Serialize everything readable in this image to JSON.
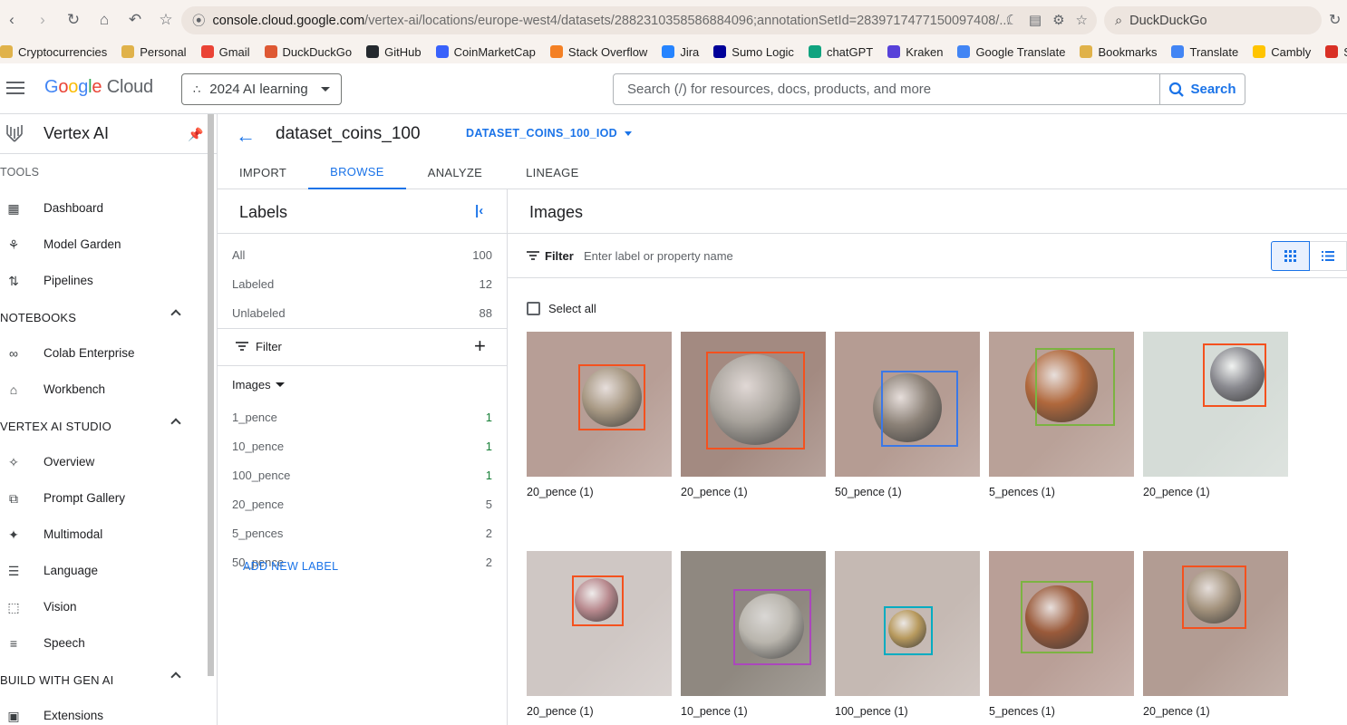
{
  "browser": {
    "url_domain": "console.cloud.google.com",
    "url_path": "/vertex-ai/locations/europe-west4/datasets/2882310358586884096;annotationSetId=2839717477150097408/...",
    "search_engine": "DuckDuckGo",
    "bookmarks": [
      {
        "label": "Cryptocurrencies",
        "color": "#e0b24a"
      },
      {
        "label": "Personal",
        "color": "#e0b24a"
      },
      {
        "label": "Gmail",
        "color": "#ea4335"
      },
      {
        "label": "DuckDuckGo",
        "color": "#de5833"
      },
      {
        "label": "GitHub",
        "color": "#24292e"
      },
      {
        "label": "CoinMarketCap",
        "color": "#3861fb"
      },
      {
        "label": "Stack Overflow",
        "color": "#f48024"
      },
      {
        "label": "Jira",
        "color": "#2684ff"
      },
      {
        "label": "Sumo Logic",
        "color": "#000099"
      },
      {
        "label": "chatGPT",
        "color": "#10a37f"
      },
      {
        "label": "Kraken",
        "color": "#5741d9"
      },
      {
        "label": "Google Translate",
        "color": "#4285f4"
      },
      {
        "label": "Bookmarks",
        "color": "#e0b24a"
      },
      {
        "label": "Translate",
        "color": "#4285f4"
      },
      {
        "label": "Cambly",
        "color": "#ffc400"
      },
      {
        "label": "SwapSw",
        "color": "#d93025"
      }
    ]
  },
  "header": {
    "logo_google": "Google",
    "logo_cloud": "Cloud",
    "project": "2024 AI learning",
    "search_placeholder": "Search (/) for resources, docs, products, and more",
    "search_button": "Search"
  },
  "sidebar": {
    "product": "Vertex AI",
    "sections": [
      {
        "title": "TOOLS",
        "collapsible": false,
        "items": [
          {
            "label": "Dashboard",
            "icon": "dashboard-icon"
          },
          {
            "label": "Model Garden",
            "icon": "model-garden-icon"
          },
          {
            "label": "Pipelines",
            "icon": "pipelines-icon"
          }
        ]
      },
      {
        "title": "NOTEBOOKS",
        "collapsible": true,
        "items": [
          {
            "label": "Colab Enterprise",
            "icon": "colab-icon"
          },
          {
            "label": "Workbench",
            "icon": "workbench-icon"
          }
        ]
      },
      {
        "title": "VERTEX AI STUDIO",
        "collapsible": true,
        "items": [
          {
            "label": "Overview",
            "icon": "overview-icon"
          },
          {
            "label": "Prompt Gallery",
            "icon": "prompt-gallery-icon"
          },
          {
            "label": "Multimodal",
            "icon": "multimodal-icon"
          },
          {
            "label": "Language",
            "icon": "language-icon"
          },
          {
            "label": "Vision",
            "icon": "vision-icon"
          },
          {
            "label": "Speech",
            "icon": "speech-icon"
          }
        ]
      },
      {
        "title": "BUILD WITH GEN AI",
        "collapsible": true,
        "items": [
          {
            "label": "Extensions",
            "icon": "extensions-icon"
          }
        ]
      }
    ]
  },
  "dataset": {
    "title": "dataset_coins_100",
    "selector": "DATASET_COINS_100_IOD",
    "tabs": [
      "IMPORT",
      "BROWSE",
      "ANALYZE",
      "LINEAGE"
    ],
    "active_tab": "BROWSE"
  },
  "labels_panel": {
    "title": "Labels",
    "counts": [
      {
        "label": "All",
        "count": "100"
      },
      {
        "label": "Labeled",
        "count": "12"
      },
      {
        "label": "Unlabeled",
        "count": "88"
      }
    ],
    "filter": "Filter",
    "images_dropdown": "Images",
    "labels": [
      {
        "label": "1_pence",
        "count": "1"
      },
      {
        "label": "10_pence",
        "count": "1"
      },
      {
        "label": "100_pence",
        "count": "1"
      },
      {
        "label": "20_pence",
        "count": "5"
      },
      {
        "label": "5_pences",
        "count": "2"
      },
      {
        "label": "50_pence",
        "count": "2"
      }
    ],
    "add_label": "ADD NEW LABEL"
  },
  "images_panel": {
    "title": "Images",
    "filter_label": "Filter",
    "filter_placeholder": "Enter label or property name",
    "select_all": "Select all",
    "images": [
      {
        "caption": "20_pence (1)",
        "bg": "#b79e96",
        "coin": "#a79883",
        "box": "#f4511e"
      },
      {
        "caption": "20_pence (1)",
        "bg": "#a38a81",
        "coin": "#a8a39c",
        "box": "#f4511e"
      },
      {
        "caption": "50_pence (1)",
        "bg": "#b59c93",
        "coin": "#8c8278",
        "box": "#3b78e7"
      },
      {
        "caption": "5_pences (1)",
        "bg": "#b9a198",
        "coin": "#b0683c",
        "box": "#7cb342"
      },
      {
        "caption": "20_pence (1)",
        "bg": "#d5dcd7",
        "coin": "#8a8a90",
        "box": "#f4511e"
      },
      {
        "caption": "20_pence (1)",
        "bg": "#cfc7c4",
        "coin": "#b8898e",
        "box": "#f4511e"
      },
      {
        "caption": "10_pence (1)",
        "bg": "#8f8880",
        "coin": "#b9b5ad",
        "box": "#ab47bc"
      },
      {
        "caption": "100_pence (1)",
        "bg": "#c5b9b3",
        "coin": "#b89a5e",
        "box": "#00acc1"
      },
      {
        "caption": "5_pences (1)",
        "bg": "#b99f97",
        "coin": "#9a5a3a",
        "box": "#7cb342"
      },
      {
        "caption": "20_pence (1)",
        "bg": "#b29c93",
        "coin": "#a3927c",
        "box": "#f4511e"
      }
    ]
  }
}
